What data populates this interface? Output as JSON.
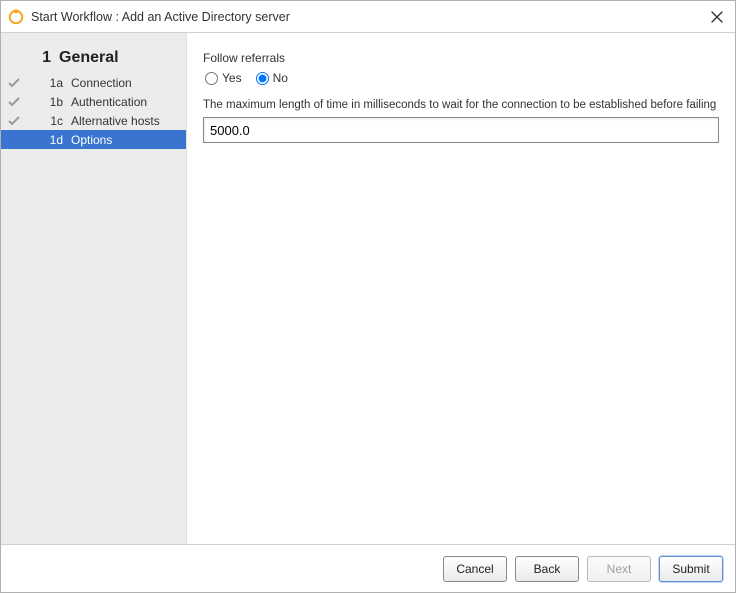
{
  "titlebar": {
    "title": "Start Workflow : Add an Active Directory server"
  },
  "sidebar": {
    "section_number": "1",
    "section_label": "General",
    "items": [
      {
        "id": "1a",
        "label": "Connection",
        "completed": true,
        "active": false
      },
      {
        "id": "1b",
        "label": "Authentication",
        "completed": true,
        "active": false
      },
      {
        "id": "1c",
        "label": "Alternative hosts",
        "completed": true,
        "active": false
      },
      {
        "id": "1d",
        "label": "Options",
        "completed": false,
        "active": true
      }
    ]
  },
  "form": {
    "follow_referrals_label": "Follow referrals",
    "follow_referrals_options": {
      "yes": "Yes",
      "no": "No"
    },
    "follow_referrals_value": "No",
    "timeout_label": "The maximum length of time in milliseconds to wait for the connection to be established before failing",
    "timeout_value": "5000.0"
  },
  "footer": {
    "cancel": "Cancel",
    "back": "Back",
    "next": "Next",
    "submit": "Submit",
    "next_enabled": false
  }
}
